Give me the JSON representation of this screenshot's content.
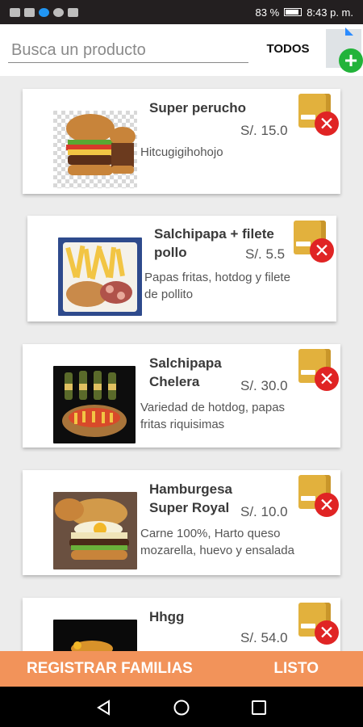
{
  "status_bar": {
    "battery": "83 %",
    "time": "8:43 p. m."
  },
  "header": {
    "search_placeholder": "Busca un producto",
    "filter_label": "TODOS",
    "add_icon": "add-document-icon"
  },
  "products": [
    {
      "name": "Super perucho",
      "price": "S/. 15.0",
      "description": "Hitcugigihohojo",
      "image": "burger-image"
    },
    {
      "name": "Salchipapa + filete pollo",
      "price": "S/. 5.5",
      "description": "Papas fritas, hotdog y filete de pollito",
      "image": "salchipapa-image"
    },
    {
      "name": "Salchipapa Chelera",
      "price": "S/. 30.0",
      "description": "Variedad de hotdog, papas fritas riquisimas",
      "image": "beer-basket-image"
    },
    {
      "name": "Hamburgesa Super Royal",
      "price": "S/. 10.0",
      "description": "Carne 100%, Harto queso mozarella, huevo y ensalada",
      "image": "royal-burger-image"
    },
    {
      "name": "Hhgg",
      "price": "S/. 54.0",
      "description": "",
      "image": "dark-food-image"
    }
  ],
  "footer": {
    "register_families_label": "REGISTRAR FAMILIAS",
    "done_label": "LISTO"
  },
  "colors": {
    "footer_bg": "#f2935a",
    "delete_red": "#e02424",
    "add_green": "#22b33a",
    "status_bar_bg": "#231f20"
  }
}
